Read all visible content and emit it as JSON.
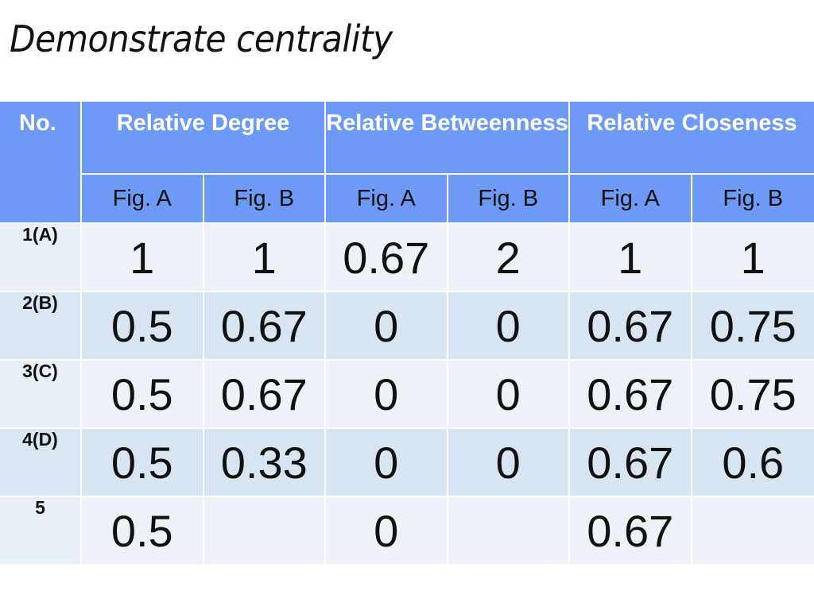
{
  "title": "Demonstrate centrality",
  "table": {
    "corner_header": "No.",
    "group_headers": [
      "Relative Degree",
      "Relative Betweenness",
      "Relative Closeness"
    ],
    "sub_headers": [
      "Fig. A",
      "Fig. B",
      "Fig. A",
      "Fig. B",
      "Fig. A",
      "Fig. B"
    ],
    "rows": [
      {
        "label": "1(A)",
        "values": [
          "1",
          "1",
          "0.67",
          "2",
          "1",
          "1"
        ]
      },
      {
        "label": "2(B)",
        "values": [
          "0.5",
          "0.67",
          "0",
          "0",
          "0.67",
          "0.75"
        ]
      },
      {
        "label": "3(C)",
        "values": [
          "0.5",
          "0.67",
          "0",
          "0",
          "0.67",
          "0.75"
        ]
      },
      {
        "label": "4(D)",
        "values": [
          "0.5",
          "0.33",
          "0",
          "0",
          "0.67",
          "0.6"
        ]
      },
      {
        "label": "5",
        "values": [
          "0.5",
          "",
          "0",
          "",
          "0.67",
          ""
        ]
      }
    ]
  },
  "colors": {
    "header_blue": "#6d9af7",
    "row_light": "#edf2f8",
    "row_dark": "#d7e5f2"
  }
}
